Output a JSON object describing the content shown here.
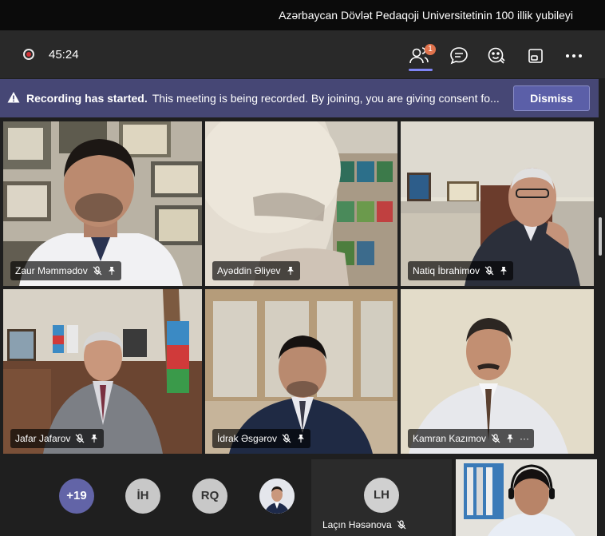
{
  "window": {
    "title": "Azərbaycan Dövlət Pedaqoji Universitetinin 100 illik yubileyi"
  },
  "toolbar": {
    "timer": "45:24",
    "participants_badge": "1",
    "icons": [
      "participants-icon",
      "chat-icon",
      "reactions-icon",
      "share-tray-icon",
      "more-options-icon"
    ]
  },
  "banner": {
    "title": "Recording has started.",
    "message": "This meeting is being recorded. By joining, you are giving consent fo...",
    "dismiss_label": "Dismiss"
  },
  "participants": [
    {
      "name": "Zaur Məmmədov",
      "muted": true,
      "pinned": true
    },
    {
      "name": "Ayəddin Əliyev",
      "muted": false,
      "pinned": true
    },
    {
      "name": "Natiq İbrahimov",
      "muted": true,
      "pinned": true
    },
    {
      "name": "Jafar Jafarov",
      "muted": true,
      "pinned": true
    },
    {
      "name": "İdrak Əsgərov",
      "muted": true,
      "pinned": true
    },
    {
      "name": "Kamran Kazımov",
      "muted": true,
      "pinned": true,
      "more": "···"
    }
  ],
  "bottom_row": {
    "overflow_count": "+19",
    "avatars": [
      "İH",
      "RQ"
    ],
    "featured": {
      "initials": "LH",
      "name": "Laçın Həsənova",
      "muted": true
    }
  },
  "colors": {
    "accent": "#6264a7",
    "banner": "#464775",
    "recording": "#d13438"
  }
}
